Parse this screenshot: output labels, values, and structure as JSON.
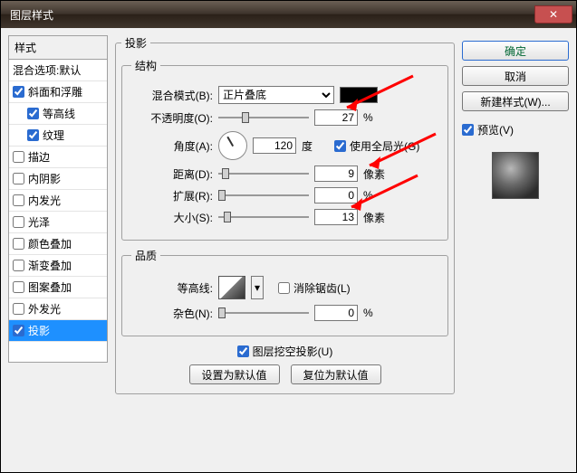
{
  "window": {
    "title": "图层样式"
  },
  "styles": {
    "header": "样式",
    "items": [
      {
        "label": "混合选项:默认",
        "checked": null
      },
      {
        "label": "斜面和浮雕",
        "checked": true
      },
      {
        "label": "等高线",
        "checked": true,
        "sub": true
      },
      {
        "label": "纹理",
        "checked": true,
        "sub": true
      },
      {
        "label": "描边",
        "checked": false
      },
      {
        "label": "内阴影",
        "checked": false
      },
      {
        "label": "内发光",
        "checked": false
      },
      {
        "label": "光泽",
        "checked": false
      },
      {
        "label": "颜色叠加",
        "checked": false
      },
      {
        "label": "渐变叠加",
        "checked": false
      },
      {
        "label": "图案叠加",
        "checked": false
      },
      {
        "label": "外发光",
        "checked": false
      },
      {
        "label": "投影",
        "checked": true,
        "selected": true
      }
    ]
  },
  "panel": {
    "title": "投影",
    "structure": {
      "legend": "结构",
      "blend_mode_label": "混合模式(B):",
      "blend_mode_value": "正片叠底",
      "opacity_label": "不透明度(O):",
      "opacity_value": "27",
      "opacity_unit": "%",
      "angle_label": "角度(A):",
      "angle_value": "120",
      "angle_unit": "度",
      "global_light_label": "使用全局光(G)",
      "global_light_checked": true,
      "distance_label": "距离(D):",
      "distance_value": "9",
      "distance_unit": "像素",
      "spread_label": "扩展(R):",
      "spread_value": "0",
      "spread_unit": "%",
      "size_label": "大小(S):",
      "size_value": "13",
      "size_unit": "像素"
    },
    "quality": {
      "legend": "品质",
      "contour_label": "等高线:",
      "antialias_label": "消除锯齿(L)",
      "antialias_checked": false,
      "noise_label": "杂色(N):",
      "noise_value": "0",
      "noise_unit": "%"
    },
    "knockout_label": "图层挖空投影(U)",
    "knockout_checked": true,
    "default_btn": "设置为默认值",
    "reset_btn": "复位为默认值"
  },
  "buttons": {
    "ok": "确定",
    "cancel": "取消",
    "new_style": "新建样式(W)...",
    "preview": "预览(V)",
    "preview_checked": true
  }
}
